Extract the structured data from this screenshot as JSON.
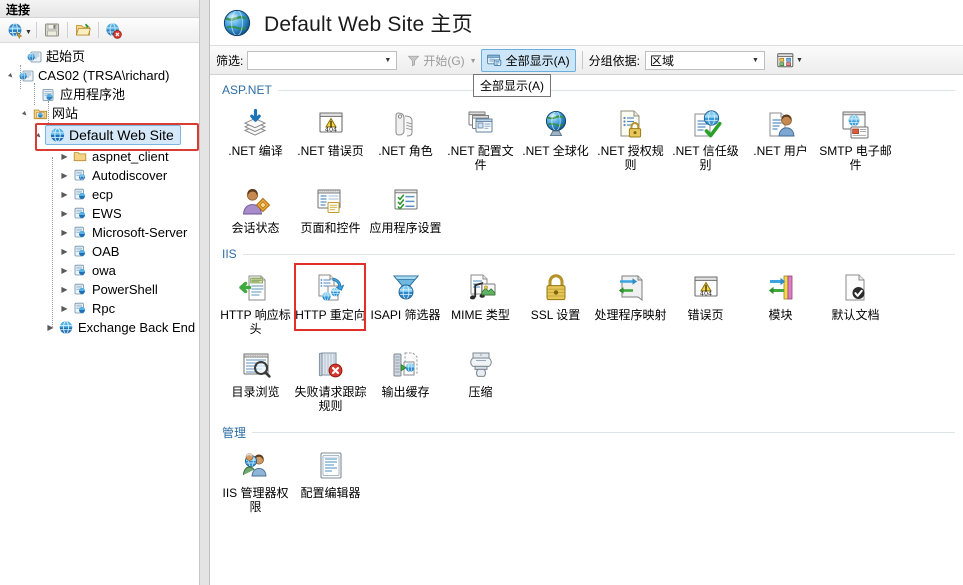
{
  "app": {
    "accent_selection": "#cde6f7",
    "highlight_red": "#e03028",
    "section_title_color": "#2c6ea4"
  },
  "connections": {
    "header": "连接",
    "toolbar": [
      {
        "name": "connect-to-icon",
        "icon": "globe-connect",
        "has_dropdown": true
      },
      {
        "name": "save-connections-icon",
        "icon": "floppy-disk"
      },
      {
        "name": "open-connection-icon",
        "icon": "folder-open"
      },
      {
        "name": "delete-connection-icon",
        "icon": "globe-delete"
      }
    ],
    "tree": [
      {
        "label": "起始页",
        "icon": "start-page",
        "indent": 0,
        "expander": "",
        "selected": false
      },
      {
        "label": "CAS02 (TRSA\\richard)",
        "icon": "server",
        "indent": 0,
        "expander": "▲",
        "selected": false
      },
      {
        "label": "应用程序池",
        "icon": "app-pool",
        "indent": 1,
        "expander": "",
        "selected": false
      },
      {
        "label": "网站",
        "icon": "sites-folder",
        "indent": 1,
        "expander": "▲",
        "selected": false
      },
      {
        "label": "Default Web Site",
        "icon": "website",
        "indent": 2,
        "expander": "▲",
        "selected": true
      },
      {
        "label": "aspnet_client",
        "icon": "folder",
        "indent": 3,
        "expander": "▶",
        "selected": false
      },
      {
        "label": "Autodiscover",
        "icon": "application",
        "indent": 3,
        "expander": "▶",
        "selected": false
      },
      {
        "label": "ecp",
        "icon": "application",
        "indent": 3,
        "expander": "▶",
        "selected": false
      },
      {
        "label": "EWS",
        "icon": "application",
        "indent": 3,
        "expander": "▶",
        "selected": false
      },
      {
        "label": "Microsoft-Server",
        "icon": "application",
        "indent": 3,
        "expander": "▶",
        "selected": false
      },
      {
        "label": "OAB",
        "icon": "application",
        "indent": 3,
        "expander": "▶",
        "selected": false
      },
      {
        "label": "owa",
        "icon": "application",
        "indent": 3,
        "expander": "▶",
        "selected": false
      },
      {
        "label": "PowerShell",
        "icon": "application",
        "indent": 3,
        "expander": "▶",
        "selected": false
      },
      {
        "label": "Rpc",
        "icon": "application",
        "indent": 3,
        "expander": "▶",
        "selected": false
      },
      {
        "label": "Exchange Back End",
        "icon": "website",
        "indent": 2,
        "expander": "▶",
        "selected": false
      }
    ]
  },
  "header": {
    "title": "Default Web Site 主页",
    "icon": "globe-icon"
  },
  "filter_bar": {
    "filter_label": "筛选:",
    "filter_value": "",
    "filter_placeholder": "",
    "go_label": "开始(G)",
    "show_all_label": "全部显示(A)",
    "group_by_label": "分组依据:",
    "group_by_value": "区域",
    "tooltip": "全部显示(A)"
  },
  "sections": [
    {
      "title": "ASP.NET",
      "items": [
        {
          "label": ".NET 编译",
          "icon": "net-compilation-icon"
        },
        {
          "label": ".NET 错误页",
          "icon": "net-error-pages-icon"
        },
        {
          "label": ".NET 角色",
          "icon": "net-roles-icon"
        },
        {
          "label": ".NET 配置文件",
          "icon": "net-profile-icon"
        },
        {
          "label": ".NET 全球化",
          "icon": "net-globalization-icon"
        },
        {
          "label": ".NET 授权规则",
          "icon": "net-authorization-rules-icon"
        },
        {
          "label": ".NET 信任级别",
          "icon": "net-trust-levels-icon"
        },
        {
          "label": ".NET 用户",
          "icon": "net-users-icon"
        },
        {
          "label": "SMTP 电子邮件",
          "icon": "smtp-email-icon"
        },
        {
          "label": "会话状态",
          "icon": "session-state-icon"
        },
        {
          "label": "页面和控件",
          "icon": "pages-and-controls-icon"
        },
        {
          "label": "应用程序设置",
          "icon": "application-settings-icon"
        }
      ]
    },
    {
      "title": "IIS",
      "items": [
        {
          "label": "HTTP 响应标头",
          "icon": "http-response-headers-icon"
        },
        {
          "label": "HTTP 重定向",
          "icon": "http-redirect-icon",
          "highlighted": true
        },
        {
          "label": "ISAPI 筛选器",
          "icon": "isapi-filters-icon"
        },
        {
          "label": "MIME 类型",
          "icon": "mime-types-icon"
        },
        {
          "label": "SSL 设置",
          "icon": "ssl-settings-icon"
        },
        {
          "label": "处理程序映射",
          "icon": "handler-mappings-icon"
        },
        {
          "label": "错误页",
          "icon": "error-pages-icon"
        },
        {
          "label": "模块",
          "icon": "modules-icon"
        },
        {
          "label": "默认文档",
          "icon": "default-document-icon"
        },
        {
          "label": "目录浏览",
          "icon": "directory-browsing-icon"
        },
        {
          "label": "失败请求跟踪规则",
          "icon": "failed-request-tracing-icon"
        },
        {
          "label": "输出缓存",
          "icon": "output-caching-icon"
        },
        {
          "label": "压缩",
          "icon": "compression-icon"
        }
      ]
    },
    {
      "title": "管理",
      "items": [
        {
          "label": "IIS 管理器权限",
          "icon": "iis-manager-permissions-icon"
        },
        {
          "label": "配置编辑器",
          "icon": "configuration-editor-icon"
        }
      ]
    }
  ]
}
